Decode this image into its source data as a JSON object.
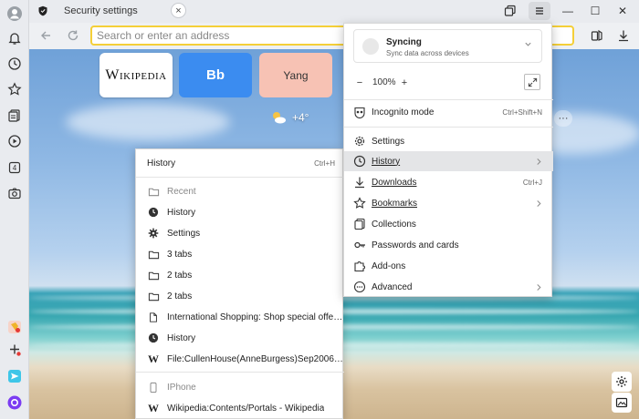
{
  "tab": {
    "title": "Security settings",
    "close_glyph": "×"
  },
  "window": {
    "menu_icon": "hamburger-icon",
    "min_glyph": "—",
    "max_glyph": "☐",
    "close_glyph": "✕"
  },
  "toolbar": {
    "address_placeholder": "Search or enter an address"
  },
  "speed_dials": [
    {
      "label": "Wikipedia"
    },
    {
      "label": "Bb"
    },
    {
      "label": "Yang"
    }
  ],
  "weather": {
    "temp": "+4°"
  },
  "more_glyph": "···",
  "menu": {
    "sync_title": "Syncing",
    "sync_subtitle": "Sync data across devices",
    "zoom_minus": "−",
    "zoom_value": "100%",
    "zoom_plus": "+",
    "items": [
      {
        "label": "Incognito mode",
        "shortcut": "Ctrl+Shift+N",
        "icon": "incognito-icon"
      },
      {
        "label": "Settings",
        "shortcut": "",
        "icon": "gear-icon"
      },
      {
        "label": "History",
        "shortcut": "",
        "icon": "clock-icon",
        "submenu": true
      },
      {
        "label": "Downloads",
        "shortcut": "Ctrl+J",
        "icon": "download-icon"
      },
      {
        "label": "Bookmarks",
        "shortcut": "",
        "icon": "star-icon",
        "submenu": true
      },
      {
        "label": "Collections",
        "shortcut": "",
        "icon": "collections-icon"
      },
      {
        "label": "Passwords and cards",
        "shortcut": "",
        "icon": "key-icon"
      },
      {
        "label": "Add-ons",
        "shortcut": "",
        "icon": "puzzle-icon"
      },
      {
        "label": "Advanced",
        "shortcut": "",
        "icon": "more-icon",
        "submenu": true
      }
    ]
  },
  "history_menu": {
    "header": "History",
    "header_shortcut": "Ctrl+H",
    "recent_label": "Recent",
    "items": [
      {
        "label": "History",
        "icon": "clock-icon"
      },
      {
        "label": "Settings",
        "icon": "gear-icon"
      },
      {
        "label": "3 tabs",
        "icon": "folder-icon"
      },
      {
        "label": "2 tabs",
        "icon": "folder-icon"
      },
      {
        "label": "2 tabs",
        "icon": "folder-icon"
      },
      {
        "label": "International Shopping: Shop special offers a...",
        "icon": "page-icon"
      },
      {
        "label": "History",
        "icon": "clock-icon"
      },
      {
        "label": "File:CullenHouse(AnneBurgess)Sep2006.jpg -...",
        "icon": "wikipedia-icon"
      }
    ],
    "device_label": "IPhone",
    "device_items": [
      {
        "label": "Wikipedia:Contents/Portals - Wikipedia",
        "icon": "wikipedia-icon"
      }
    ]
  }
}
